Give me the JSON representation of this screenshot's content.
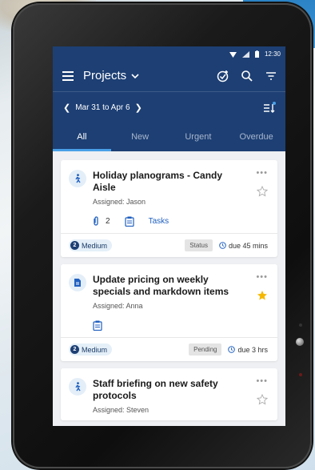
{
  "statusbar": {
    "time": "12:30"
  },
  "toolbar": {
    "title": "Projects"
  },
  "datebar": {
    "range": "Mar 31 to Apr 6"
  },
  "tabs": [
    {
      "label": "All",
      "active": true
    },
    {
      "label": "New",
      "active": false
    },
    {
      "label": "Urgent",
      "active": false
    },
    {
      "label": "Overdue",
      "active": false
    }
  ],
  "cards": [
    {
      "title": "Holiday planograms - Candy Aisle",
      "assigned": "Assigned: Jason",
      "attachments": "2",
      "tasks_label": "Tasks",
      "priority_num": "2",
      "priority": "Medium",
      "status": "Status",
      "due": "due 45 mins",
      "starred": false
    },
    {
      "title": "Update pricing on weekly specials and markdown items",
      "assigned": "Assigned: Anna",
      "priority_num": "2",
      "priority": "Medium",
      "status": "Pending",
      "due": "due 3 hrs",
      "starred": true
    },
    {
      "title": "Staff briefing on new safety protocols",
      "assigned": "Assigned: Steven",
      "starred": false
    }
  ],
  "colors": {
    "appbar": "#1d3f74",
    "accent": "#4aa0e8",
    "star": "#f5b800",
    "link": "#1f5fbf"
  }
}
